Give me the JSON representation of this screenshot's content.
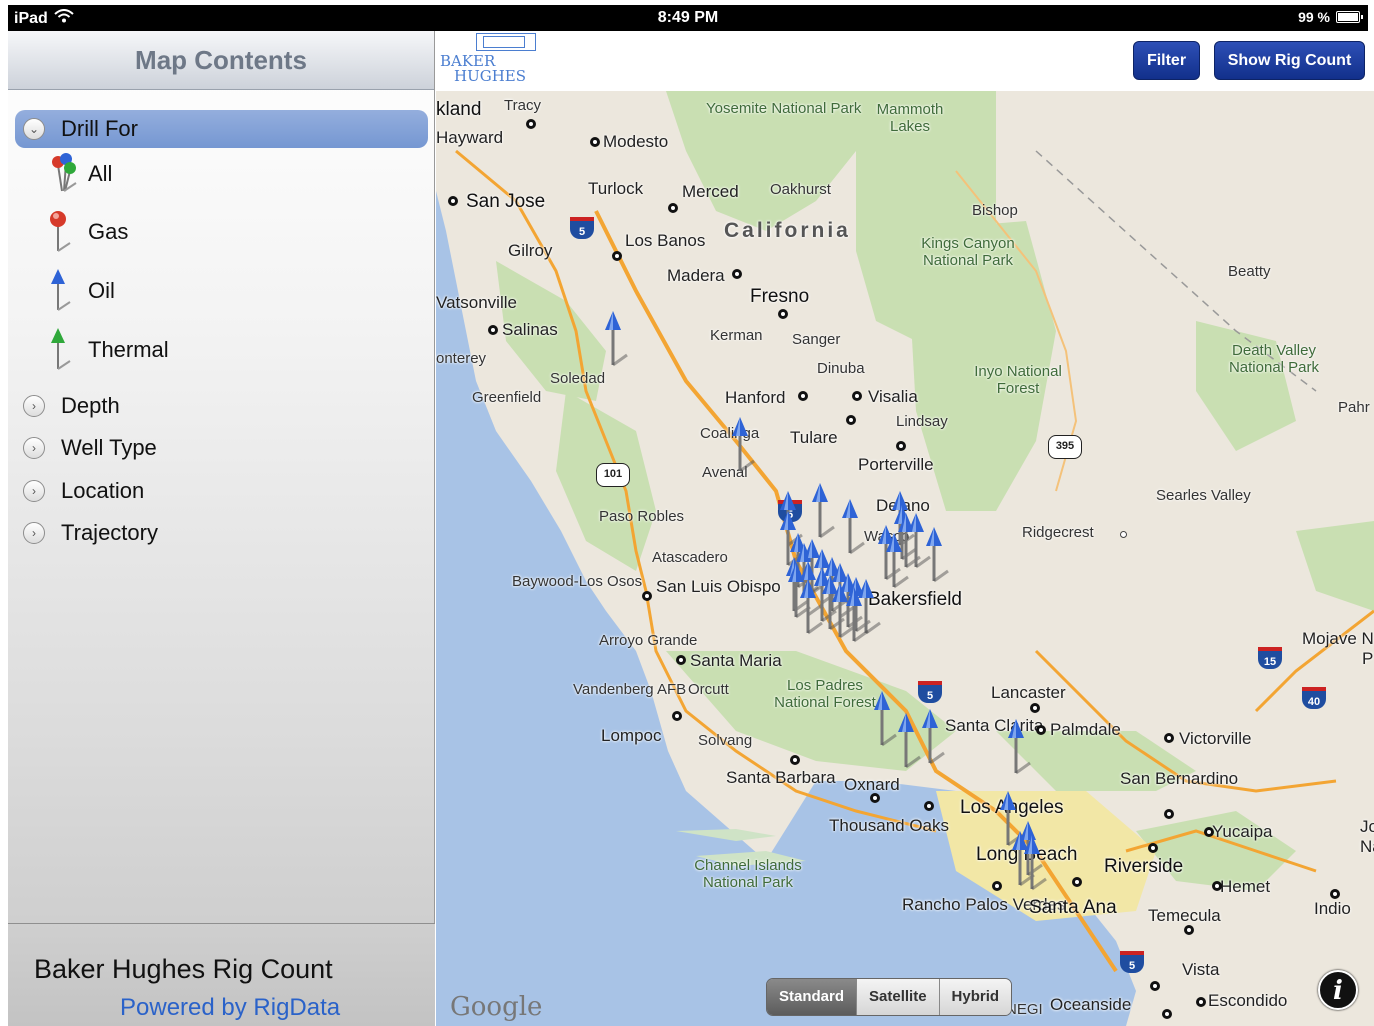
{
  "status_bar": {
    "device": "iPad",
    "time": "8:49 PM",
    "battery": "99 %"
  },
  "sidebar": {
    "title": "Map Contents",
    "drill_for": {
      "label": "Drill For",
      "items": [
        {
          "label": "All",
          "icon": "multi-pin-icon"
        },
        {
          "label": "Gas",
          "icon": "red-pin-icon",
          "color": "#d63a2a"
        },
        {
          "label": "Oil",
          "icon": "blue-pin-icon",
          "color": "#2e63d6"
        },
        {
          "label": "Thermal",
          "icon": "green-pin-icon",
          "color": "#2fa83a"
        }
      ]
    },
    "sections": [
      {
        "label": "Depth"
      },
      {
        "label": "Well Type"
      },
      {
        "label": "Location"
      },
      {
        "label": "Trajectory"
      }
    ],
    "footer": {
      "title": "Baker Hughes Rig Count",
      "powered": "Powered by RigData"
    }
  },
  "toolbar": {
    "logo": {
      "line1": "BAKER",
      "line2": "HUGHES"
    },
    "filter_label": "Filter",
    "rig_count_label": "Show Rig Count"
  },
  "map": {
    "provider": "Google",
    "map_types": [
      "Standard",
      "Satellite",
      "Hybrid"
    ],
    "selected_type": "Standard",
    "region_label": "California",
    "cities": [
      "kland",
      "Tracy",
      "Hayward",
      "Modesto",
      "Turlock",
      "Merced",
      "Oakhurst",
      "San Jose",
      "Los Banos",
      "Gilroy",
      "Madera",
      "Fresno",
      "Kerman",
      "Sanger",
      "Vatsonville",
      "Salinas",
      "onterey",
      "Soledad",
      "Greenfield",
      "Dinuba",
      "Hanford",
      "Visalia",
      "Lindsay",
      "Coalinga",
      "Tulare",
      "Avenal",
      "Porterville",
      "Paso Robles",
      "Delano",
      "Wasco",
      "Atascadero",
      "Baywood-Los Osos",
      "San Luis Obispo",
      "Bakersfield",
      "Arroyo Grande",
      "Santa Maria",
      "Vandenberg AFB",
      "Orcutt",
      "Lompoc",
      "Solvang",
      "Lancaster",
      "Santa Clarita",
      "Palmdale",
      "Victorville",
      "Santa Barbara",
      "Oxnard",
      "Los Angeles",
      "San Bernardino",
      "Thousand Oaks",
      "Yucaipa",
      "Long Beach",
      "Riverside",
      "Rancho Palos Verdes",
      "Santa Ana",
      "Hemet",
      "Temecula",
      "Indio",
      "Vista",
      "Oceanside",
      "Escondido",
      "Bishop",
      "Beatty",
      "Ridgecrest",
      "Searles Valley",
      "Mojave N",
      "Pahr",
      "P",
      "Jo",
      "Na",
      "NEGI"
    ],
    "parks": [
      "Yosemite National Park",
      "Mammoth Lakes",
      "Kings Canyon National Park",
      "Inyo National Forest",
      "Death Valley National Park",
      "Los Padres National Forest",
      "Channel Islands National Park"
    ],
    "highways": [
      "5",
      "101",
      "395",
      "15",
      "40"
    ],
    "rig_pin_count": 38
  }
}
